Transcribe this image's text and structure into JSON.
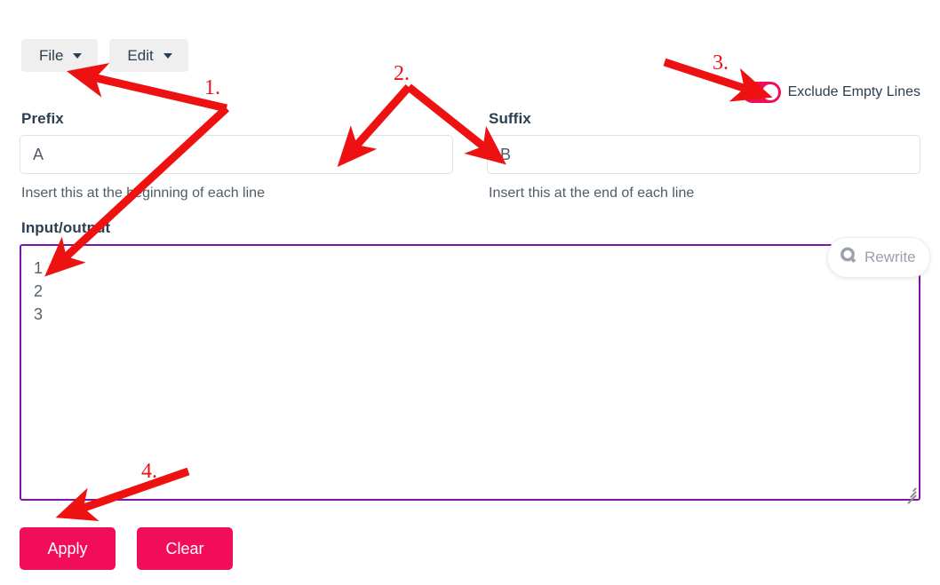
{
  "menubar": {
    "items": [
      {
        "label": "File",
        "icon": "chevron-down-icon"
      },
      {
        "label": "Edit",
        "icon": "chevron-down-icon"
      }
    ]
  },
  "toggle": {
    "label": "Exclude Empty Lines",
    "state": "on",
    "color": "#f20d5b"
  },
  "prefix": {
    "label": "Prefix",
    "value": "A",
    "placeholder": "",
    "helper": "Insert this at the beginning of each line"
  },
  "suffix": {
    "label": "Suffix",
    "value": "B",
    "placeholder": "",
    "helper": "Insert this at the end of each line"
  },
  "io": {
    "label": "Input/output",
    "value": "1\n2\n3",
    "placeholder": "",
    "border_color": "#7a15a8"
  },
  "rewrite": {
    "label": "Rewrite",
    "icon": "rewrite-circle-icon"
  },
  "actions": {
    "apply_label": "Apply",
    "clear_label": "Clear",
    "color": "#f20d5b"
  },
  "annotations": {
    "color": "#ee1111",
    "items": [
      {
        "number": "1."
      },
      {
        "number": "2."
      },
      {
        "number": "3."
      },
      {
        "number": "4."
      }
    ]
  }
}
